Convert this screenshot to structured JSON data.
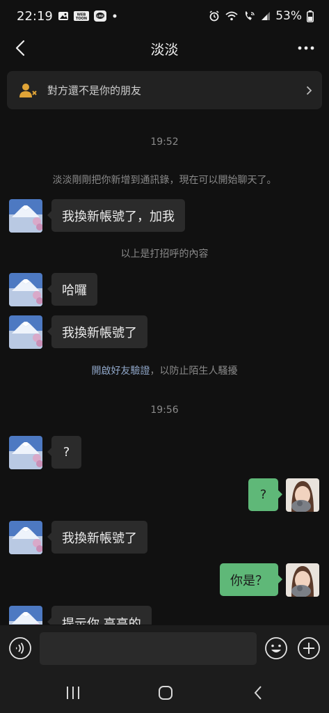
{
  "status_bar": {
    "time": "22:19",
    "battery": "53%",
    "left_icons": [
      "gallery-icon",
      "webtoon-icon",
      "line-icon",
      "dot-icon"
    ],
    "right_icons": [
      "alarm-icon",
      "wifi-icon",
      "wifi-call-icon",
      "signal-icon",
      "battery-icon"
    ],
    "webtoon_label": "WEB TOON"
  },
  "header": {
    "title": "淡淡",
    "back_icon": "chevron-left-icon",
    "more_icon": "more-dots-icon"
  },
  "banner": {
    "text": "對方還不是你的朋友",
    "icon": "add-friend-icon",
    "accent": "#e0a437"
  },
  "chat": {
    "time_1": "19:52",
    "system_1": "淡淡剛剛把你新增到通訊錄，現在可以開始聊天了。",
    "msg_1": "我換新帳號了，加我",
    "system_2": "以上是打招呼的內容",
    "msg_2": "哈囉",
    "msg_3": "我換新帳號了",
    "system_3_link": "開啟好友驗證",
    "system_3_rest": "，以防止陌生人騷擾",
    "time_2": "19:56",
    "msg_4": "?",
    "msg_5_self": "?",
    "msg_6": "我換新帳號了",
    "msg_7_self": "你是？",
    "msg_8_partial": "提示你 高高的"
  },
  "input_bar": {
    "voice_icon": "voice-icon",
    "emoji_icon": "emoji-icon",
    "plus_icon": "plus-icon",
    "placeholder": ""
  },
  "system_nav": {
    "recents_icon": "recents-icon",
    "home_icon": "home-icon",
    "back_icon": "back-icon"
  },
  "colors": {
    "background": "#111111",
    "bubble_in": "#2b2b2b",
    "bubble_out": "#5fb878",
    "link": "#8fa6c8"
  }
}
